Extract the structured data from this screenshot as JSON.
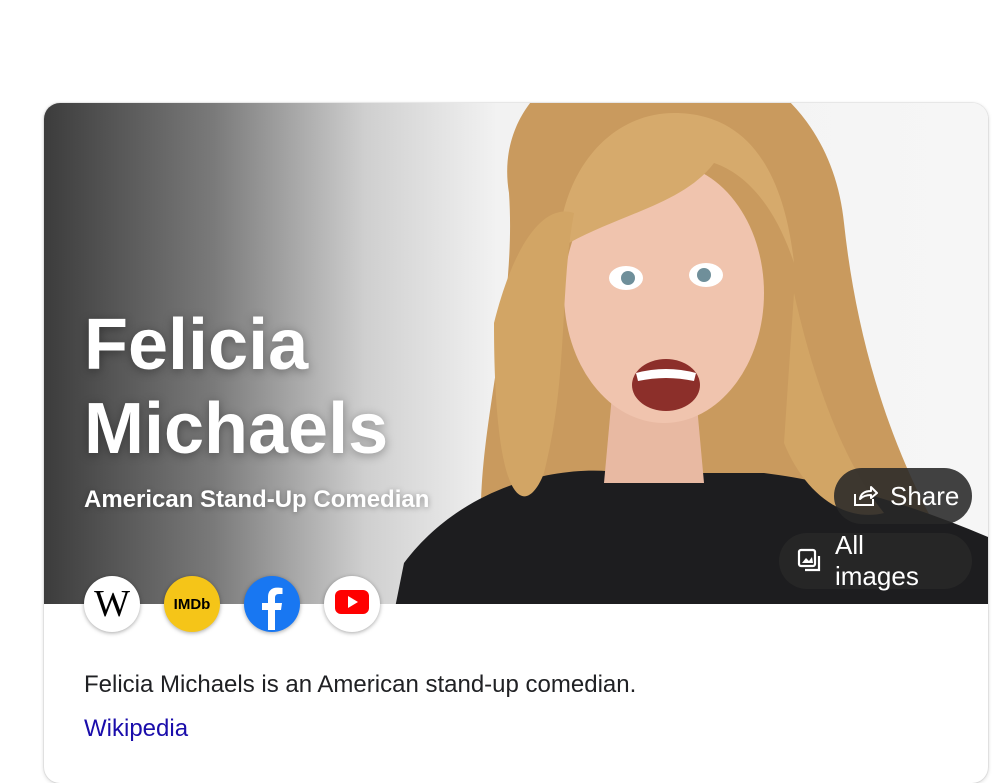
{
  "panel": {
    "title": "Felicia Michaels",
    "subtitle": "American Stand-Up Comedian",
    "description": "Felicia Michaels is an American stand-up comedian.",
    "source_link": "Wikipedia"
  },
  "actions": {
    "share_label": "Share",
    "share_icon": "share-arrow-icon",
    "all_images_label": "All images",
    "all_images_icon": "image-stack-icon"
  },
  "sources": {
    "wikipedia": {
      "glyph": "W",
      "icon": "wikipedia-icon"
    },
    "imdb": {
      "glyph": "IMDb",
      "icon": "imdb-icon",
      "color": "#F5C518"
    },
    "facebook": {
      "icon": "facebook-icon",
      "color": "#1877F2"
    },
    "youtube": {
      "icon": "youtube-icon",
      "color": "#FF0000"
    }
  },
  "colors": {
    "link": "#1a0dab",
    "text": "#202124",
    "pill_background": "#282828"
  }
}
